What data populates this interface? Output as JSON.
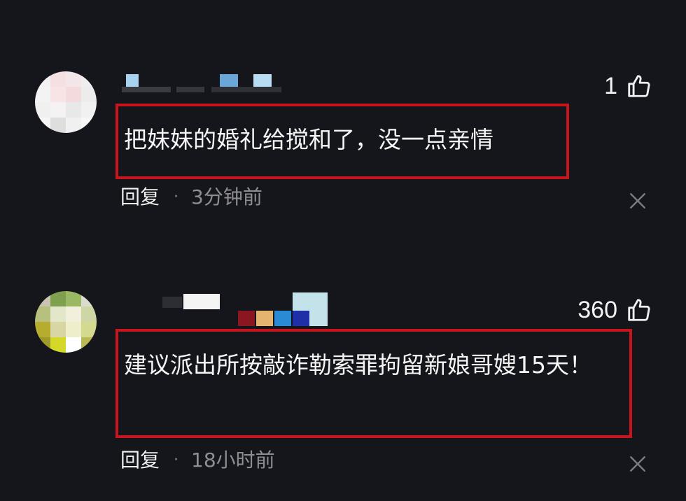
{
  "comments": [
    {
      "likes": "1",
      "text": "把妹妹的婚礼给搅和了，没一点亲情",
      "reply_label": "回复",
      "separator": "·",
      "time": "3分钟前"
    },
    {
      "likes": "360",
      "text": "建议派出所按敲诈勒索罪拘留新娘哥嫂15天！",
      "reply_label": "回复",
      "separator": "·",
      "time": "18小时前"
    }
  ],
  "colors": {
    "background": "#15161b",
    "highlight_border": "#c8141c",
    "meta_text": "#8e8e93"
  },
  "icons": [
    "thumbs-up-icon",
    "close-icon"
  ]
}
